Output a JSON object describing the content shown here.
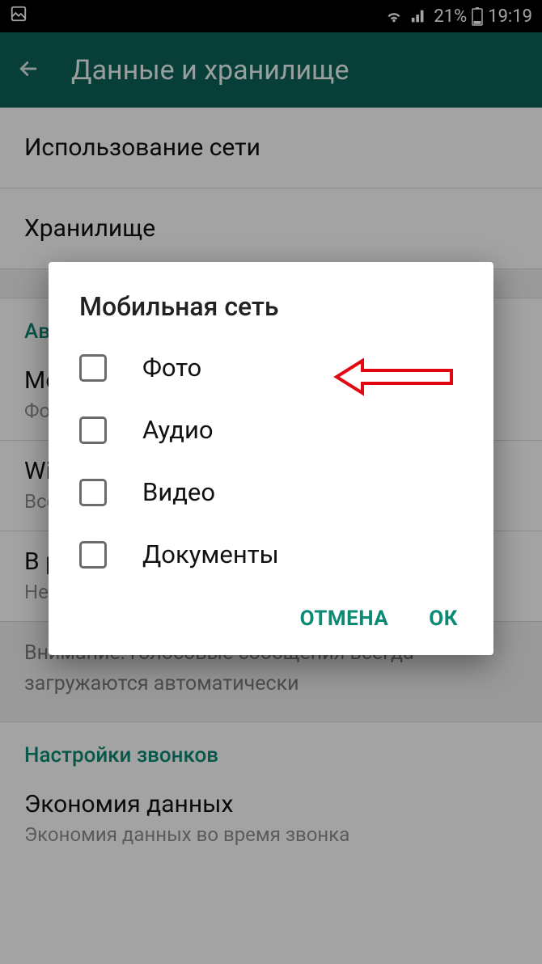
{
  "status": {
    "battery_pct": "21%",
    "time": "19:19"
  },
  "appbar": {
    "title": "Данные и хранилище"
  },
  "list": {
    "network_usage": "Использование сети",
    "storage": "Хранилище",
    "auto_download_header": "Автозагрузка медиа",
    "mobile": {
      "title": "Мобильная сеть",
      "sub": "Фото"
    },
    "wifi": {
      "title": "Wi-Fi",
      "sub": "Все медиа"
    },
    "roaming": {
      "title": "В роуминге",
      "sub": "Нет медиа"
    },
    "help_text": "Внимание: голосовые сообщения всегда загружаются автоматически",
    "calls_header": "Настройки звонков",
    "data_saving": {
      "title": "Экономия данных",
      "sub": "Экономия данных во время звонка"
    }
  },
  "dialog": {
    "title": "Мобильная сеть",
    "options": {
      "photo": "Фото",
      "audio": "Аудио",
      "video": "Видео",
      "docs": "Документы"
    },
    "cancel": "ОТМЕНА",
    "ok": "ОК"
  }
}
